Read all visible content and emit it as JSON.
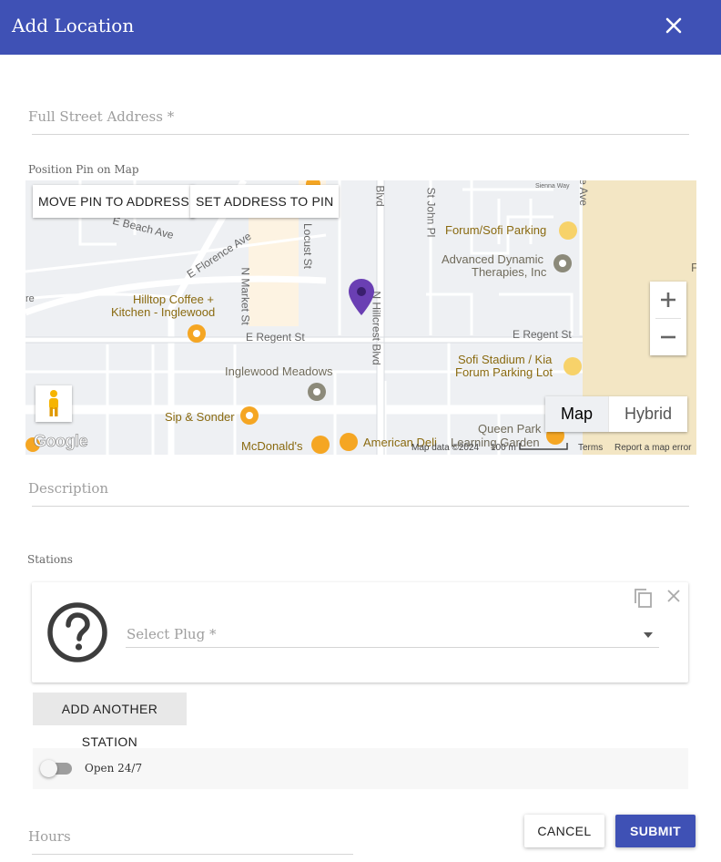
{
  "dialog": {
    "title": "Add Location",
    "close_icon": "close-icon"
  },
  "address": {
    "label": "Full Street Address *",
    "value": ""
  },
  "map_section": {
    "label": "Position Pin on Map",
    "move_pin_label": "MOVE PIN TO ADDRESS",
    "set_address_label": "SET ADDRESS TO PIN",
    "map_type_options": [
      "Map",
      "Hybrid"
    ],
    "map_type_selected": "Map",
    "zoom_in_label": "+",
    "zoom_out_label": "−",
    "google_logo": "Google",
    "attribution": {
      "map_data": "Map data ©2024",
      "scale": "100 m",
      "terms": "Terms",
      "report": "Report a map error"
    },
    "streets": [
      "E Beach Ave",
      "E Florence Ave",
      "N Market St",
      "Locust St",
      "N Hillcrest Blvd",
      "St John Pl",
      "E Regent St",
      "E Regent St",
      "Blvd",
      "Sienna Way",
      "e Ave",
      "re"
    ],
    "places": [
      "Forum/Sofi Parking",
      "Advanced Dynamic",
      "Therapies, Inc",
      "Hilltop Coffee +",
      "Kitchen - Inglewood",
      "Sofi Stadium / Kia",
      "Forum Parking Lot",
      "Inglewood Meadows",
      "Sip & Sonder",
      "Queen Park",
      "McDonald's",
      "American Deli",
      "Learning Garden",
      "F"
    ],
    "colors": {
      "pin": "#6a3fb3",
      "road": "#ffffff",
      "land": "#eef0f3",
      "parking_area": "#f3e6c4",
      "poi_orange": "#f5a623",
      "poi_gray": "#8c8a7a"
    }
  },
  "description": {
    "label": "Description",
    "value": ""
  },
  "stations": {
    "label": "Stations",
    "items": [
      {
        "icon": "question-circle-icon",
        "select_label": "Select Plug *",
        "value": ""
      }
    ],
    "add_label": "ADD ANOTHER STATION"
  },
  "open_247": {
    "label": "Open 24/7",
    "checked": false
  },
  "hours": {
    "label": "Hours",
    "value": ""
  },
  "actions": {
    "cancel_label": "CANCEL",
    "submit_label": "SUBMIT"
  },
  "theme": {
    "primary": "#3f51b5"
  }
}
